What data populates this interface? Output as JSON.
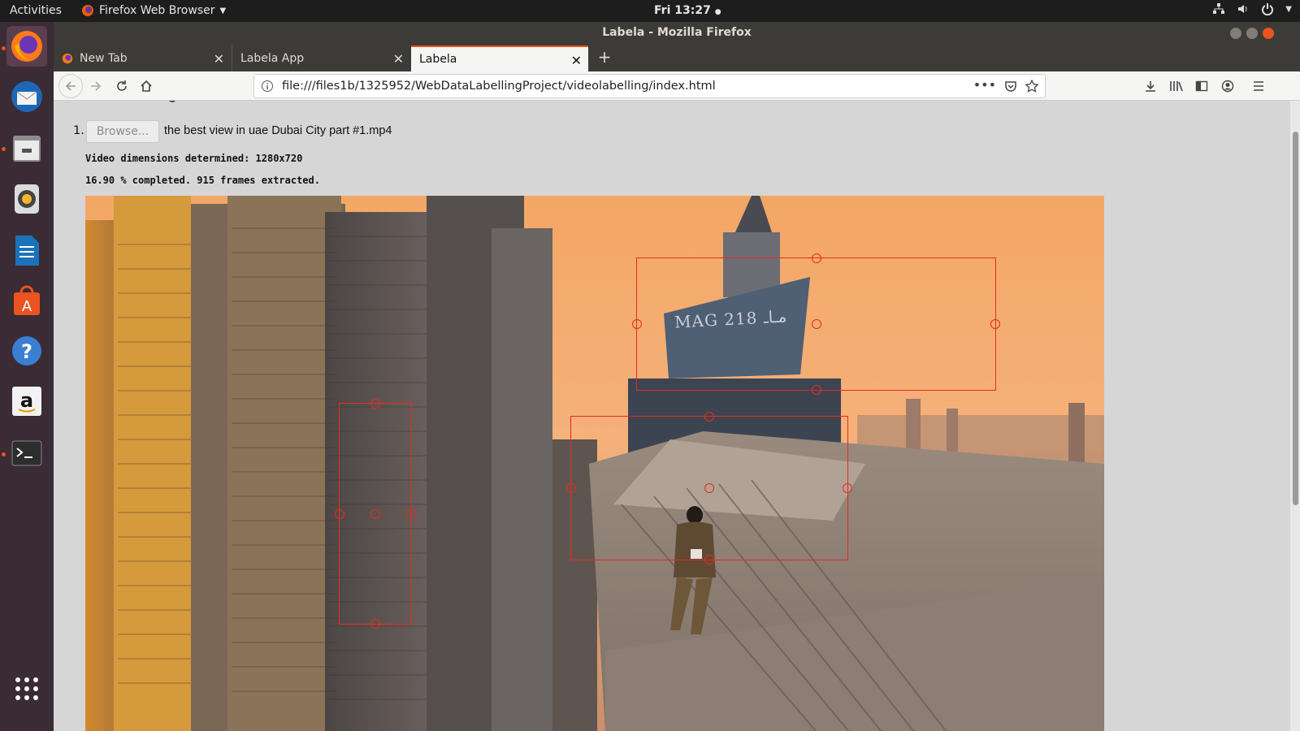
{
  "system": {
    "activities": "Activities",
    "app_menu": "Firefox Web Browser",
    "clock": "Fri 13:27"
  },
  "window": {
    "title": "Labela - Mozilla Firefox"
  },
  "tabs": [
    {
      "label": "New Tab",
      "active": false
    },
    {
      "label": "Labela App",
      "active": false
    },
    {
      "label": "Labela",
      "active": true
    }
  ],
  "navbar": {
    "url": "file:///files1b/1325952/WebDataLabellingProject/videolabelling/index.html",
    "more_icon": "ellipsis-icon"
  },
  "page": {
    "list_number": "1.",
    "browse_label": "Browse...",
    "file_name": "the best view in uae Dubai City part #1.mp4",
    "dimensions_text": "Video dimensions determined: 1280x720",
    "progress_text": "16.90 % completed. 915 frames extracted.",
    "building_sign": "MAG 218 مـاـ"
  },
  "annotations": {
    "box_count": 3,
    "stroke_color": "#e52b1f"
  },
  "colors": {
    "accent": "#e95420",
    "dock_bg": "#3b2b35",
    "topbar_bg": "#1d1d1d",
    "page_bg": "#d6d6d6"
  }
}
